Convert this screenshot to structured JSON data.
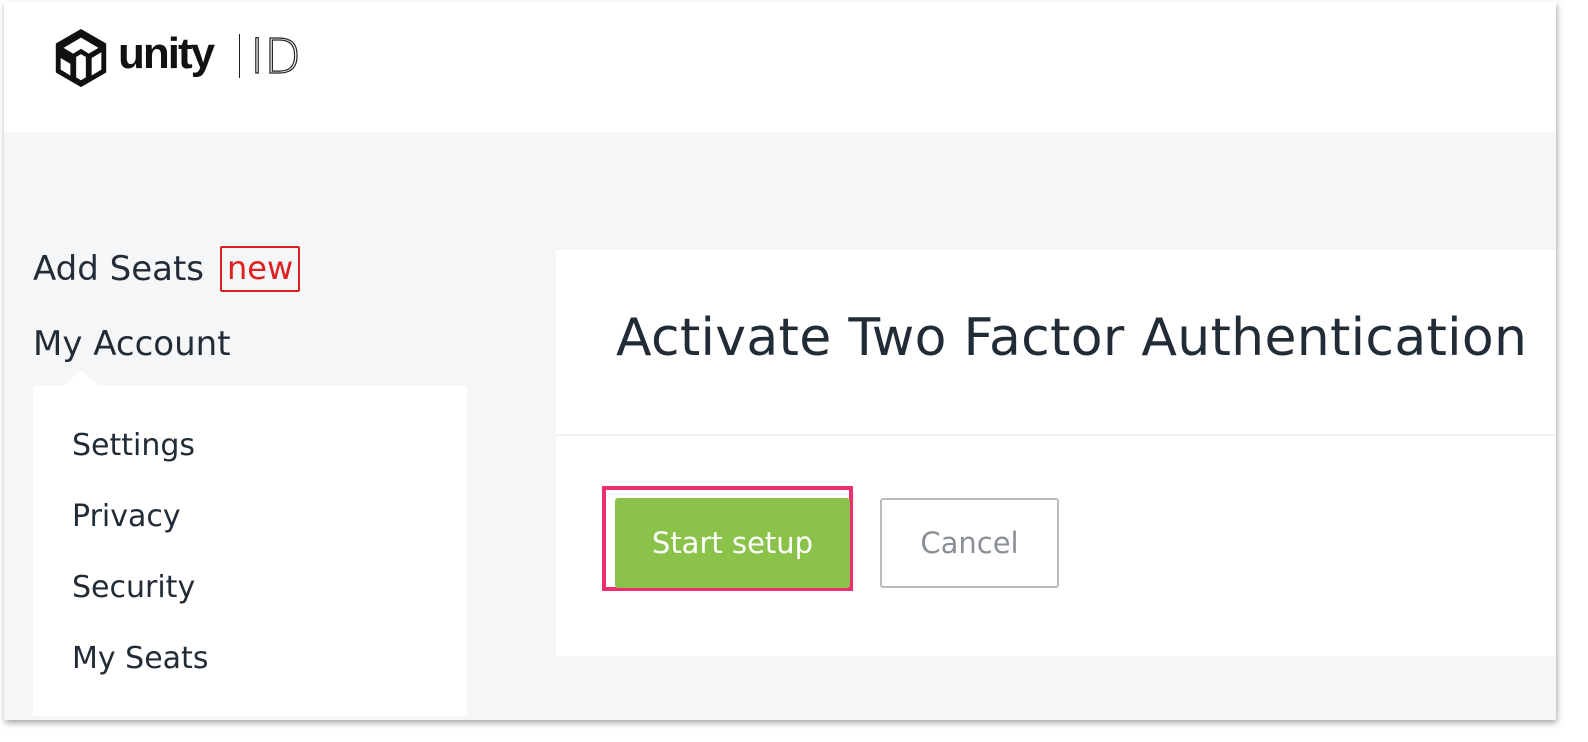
{
  "brand": {
    "wordmark": "unity",
    "product": "ID"
  },
  "sidebar": {
    "add_seats_label": "Add Seats",
    "new_badge": "new",
    "my_account_label": "My Account",
    "items": [
      {
        "label": "Settings"
      },
      {
        "label": "Privacy"
      },
      {
        "label": "Security"
      },
      {
        "label": "My Seats"
      }
    ]
  },
  "main": {
    "title": "Activate Two Factor Authentication",
    "start_button": "Start setup",
    "cancel_button": "Cancel"
  },
  "colors": {
    "primary_button": "#8bc34a",
    "highlight": "#ee2e6e",
    "badge": "#e02020",
    "background": "#f4f6f7"
  }
}
